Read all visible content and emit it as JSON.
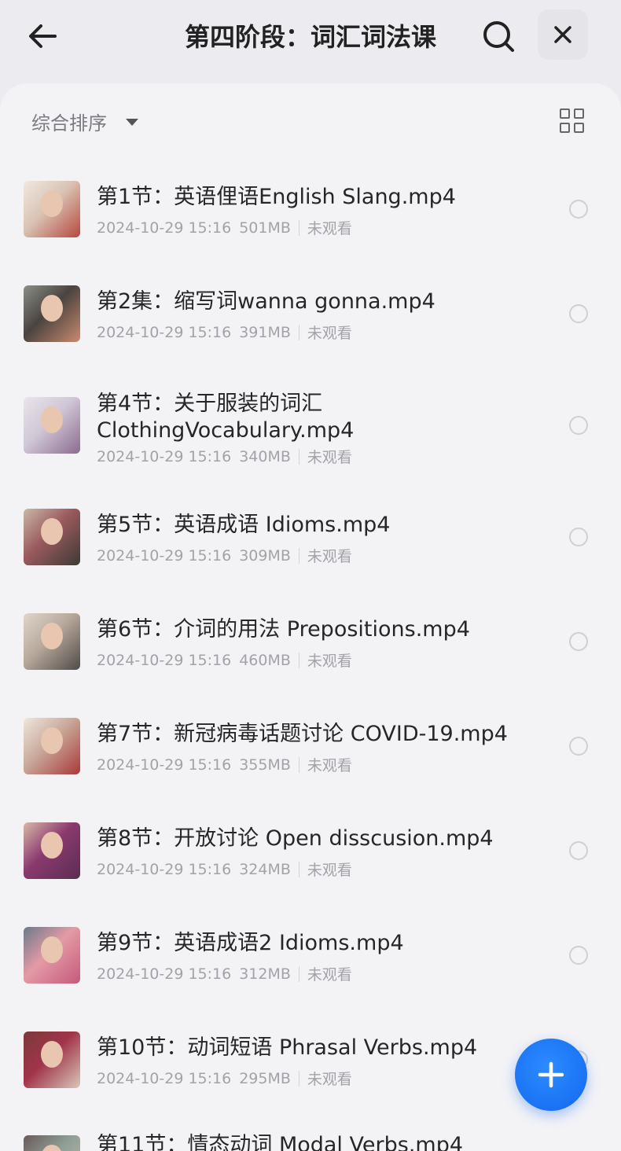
{
  "header": {
    "back_icon": "arrow-left-icon",
    "title": "第四阶段：词汇词法课",
    "search_icon": "search-icon",
    "close_icon": "close-icon"
  },
  "toolbar": {
    "sort_label": "综合排序",
    "view_toggle_icon": "grid-view-icon"
  },
  "files": [
    {
      "name": "第1节：英语俚语English Slang.mp4",
      "date": "2024-10-29 15:16",
      "size": "501MB",
      "status": "未观看",
      "thumb_colors": [
        "#d8c3b4",
        "#b8473e",
        "#f2e8df"
      ]
    },
    {
      "name": "第2集：缩写词wanna gonna.mp4",
      "date": "2024-10-29 15:16",
      "size": "391MB",
      "status": "未观看",
      "thumb_colors": [
        "#4a4340",
        "#c98a6e",
        "#8a8f86"
      ]
    },
    {
      "name": "第4节：关于服装的词汇 ClothingVocabulary.mp4",
      "date": "2024-10-29 15:16",
      "size": "340MB",
      "status": "未观看",
      "thumb_colors": [
        "#cfc7d6",
        "#8c6a8f",
        "#eae4ea"
      ]
    },
    {
      "name": "第5节：英语成语 Idioms.mp4",
      "date": "2024-10-29 15:16",
      "size": "309MB",
      "status": "未观看",
      "thumb_colors": [
        "#9a5a5d",
        "#3d3a36",
        "#c9b8a8"
      ]
    },
    {
      "name": "第6节：介词的用法 Prepositions.mp4",
      "date": "2024-10-29 15:16",
      "size": "460MB",
      "status": "未观看",
      "thumb_colors": [
        "#b7a89b",
        "#4e4b48",
        "#e0d6cc"
      ]
    },
    {
      "name": "第7节：新冠病毒话题讨论 COVID-19.mp4",
      "date": "2024-10-29 15:16",
      "size": "355MB",
      "status": "未观看",
      "thumb_colors": [
        "#c9a89a",
        "#a8393a",
        "#efe6dd"
      ]
    },
    {
      "name": "第8节：开放讨论 Open disscusion.mp4",
      "date": "2024-10-29 15:16",
      "size": "324MB",
      "status": "未观看",
      "thumb_colors": [
        "#8a3a6e",
        "#5b2c52",
        "#d8b8a8"
      ]
    },
    {
      "name": "第9节：英语成语2 Idioms.mp4",
      "date": "2024-10-29 15:16",
      "size": "312MB",
      "status": "未观看",
      "thumb_colors": [
        "#e49aa6",
        "#c45a7a",
        "#6a7a8a"
      ]
    },
    {
      "name": "第10节：动词短语 Phrasal Verbs.mp4",
      "date": "2024-10-29 15:16",
      "size": "295MB",
      "status": "未观看",
      "thumb_colors": [
        "#a2344a",
        "#d8c8b8",
        "#7a3a3a"
      ]
    },
    {
      "name": "第11节：情态动词 Modal Verbs.mp4",
      "date": "",
      "size": "",
      "status": "",
      "thumb_colors": [
        "#8fa098",
        "#c8b8a8",
        "#6a5a58"
      ]
    }
  ],
  "fab": {
    "icon": "plus-icon"
  },
  "colors": {
    "accent": "#1a73f5",
    "background": "#ececf0",
    "panel": "#f3f3f6"
  }
}
